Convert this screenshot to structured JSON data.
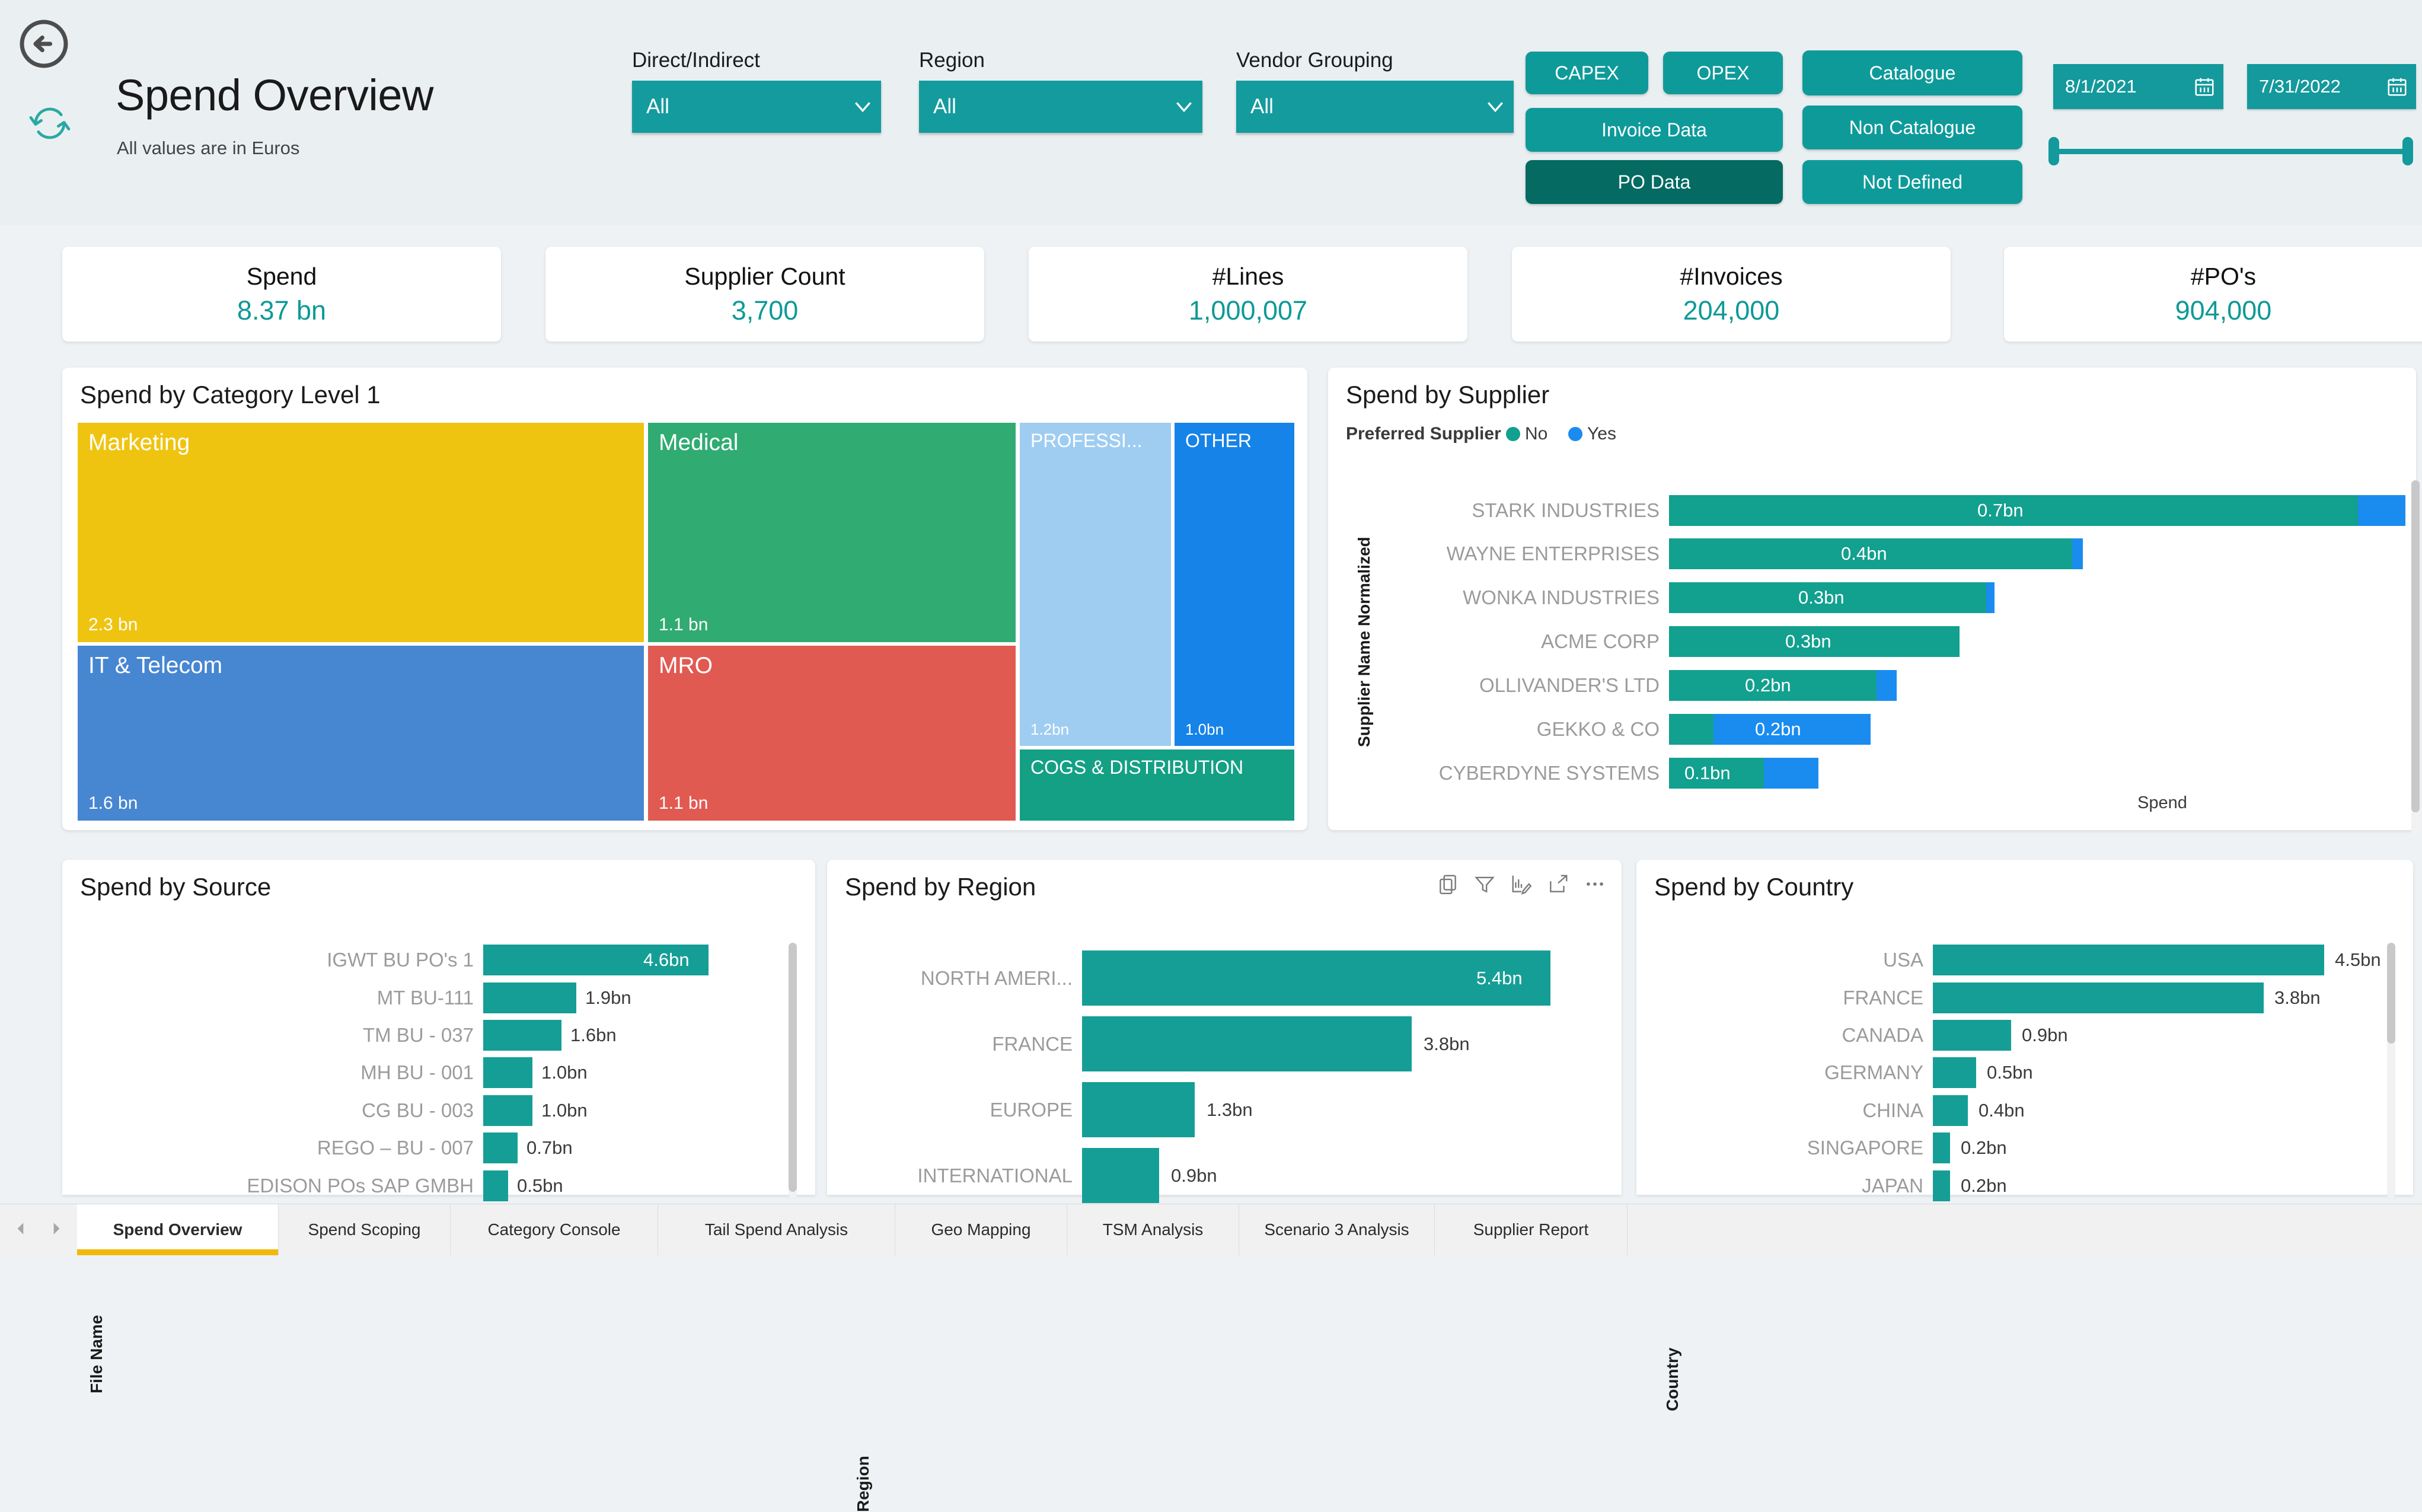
{
  "header": {
    "title": "Spend Overview",
    "subtitle": "All values are in Euros",
    "back_icon": "back-arrow-icon",
    "refresh_icon": "refresh-icon"
  },
  "slicers": [
    {
      "label": "Direct/Indirect",
      "value": "All"
    },
    {
      "label": "Region",
      "value": "All"
    },
    {
      "label": "Vendor Grouping",
      "value": "All"
    }
  ],
  "buttons": [
    {
      "label": "CAPEX",
      "selected": false
    },
    {
      "label": "OPEX",
      "selected": false
    },
    {
      "label": "Catalogue",
      "selected": false
    },
    {
      "label": "Invoice Data",
      "selected": false
    },
    {
      "label": "Non Catalogue",
      "selected": false
    },
    {
      "label": "PO Data",
      "selected": true
    },
    {
      "label": "Not Defined",
      "selected": false
    }
  ],
  "date_range": {
    "start": "8/1/2021",
    "end": "7/31/2022"
  },
  "kpis": [
    {
      "title": "Spend",
      "value": "8.37 bn"
    },
    {
      "title": "Supplier Count",
      "value": "3,700"
    },
    {
      "title": "#Lines",
      "value": "1,000,007"
    },
    {
      "title": "#Invoices",
      "value": "204,000"
    },
    {
      "title": "#PO's",
      "value": "904,000"
    }
  ],
  "panels": {
    "category": {
      "title": "Spend by Category Level 1"
    },
    "supplier": {
      "title": "Spend by Supplier",
      "legend_title": "Preferred Supplier",
      "y_axis": "Supplier Name Normalized",
      "x_axis": "Spend"
    },
    "source": {
      "title": "Spend by Source",
      "y_axis": "File Name"
    },
    "region": {
      "title": "Spend by Region",
      "y_axis": "Region"
    },
    "country": {
      "title": "Spend by Country",
      "y_axis": "Country"
    }
  },
  "viz_toolbar": [
    "copy-icon",
    "filter-icon",
    "personalize-visual-icon",
    "focus-mode-icon",
    "more-options-icon"
  ],
  "colors": {
    "teal": "#0f9a9a",
    "teal_dark": "#046a62",
    "bar_teal": "#159e96",
    "bar_blue": "#1a8cf0",
    "accent_yellow": "#f2b80c"
  },
  "chart_data": [
    {
      "type": "treemap",
      "title": "Spend by Category Level 1",
      "labels": [
        "Marketing",
        "IT & Telecom",
        "Medical",
        "MRO",
        "PROFESSI...",
        "OTHER",
        "COGS & DISTRIBUTION"
      ],
      "values": [
        2.3,
        1.6,
        1.1,
        1.1,
        1.2,
        1.0,
        0.6
      ],
      "value_labels": [
        "2.3 bn",
        "1.6 bn",
        "1.1 bn",
        "1.1 bn",
        "1.2bn",
        "1.0bn",
        ""
      ],
      "colors": [
        "#efc411",
        "#4786d1",
        "#30ab72",
        "#e15a52",
        "#9fcdf2",
        "#1683e8",
        "#14a085"
      ],
      "units": "bn EUR"
    },
    {
      "type": "bar",
      "orientation": "horizontal",
      "stacked": true,
      "title": "Spend by Supplier",
      "ylabel": "Supplier Name Normalized",
      "xlabel": "Spend",
      "categories": [
        "STARK INDUSTRIES",
        "WAYNE ENTERPRISES",
        "WONKA INDUSTRIES",
        "ACME CORP",
        "OLLIVANDER'S LTD",
        "GEKKO & CO",
        "CYBERDYNE SYSTEMS"
      ],
      "legend": [
        {
          "name": "No",
          "color": "#12a08f"
        },
        {
          "name": "Yes",
          "color": "#1a8cf0"
        }
      ],
      "legend_position": "top-left",
      "series": [
        {
          "name": "No",
          "values": [
            0.7,
            0.42,
            0.33,
            0.3,
            0.215,
            0.055,
            0.1
          ]
        },
        {
          "name": "Yes",
          "values": [
            0.048,
            0.01,
            0.008,
            0.0,
            0.03,
            0.165,
            0.095
          ]
        }
      ],
      "data_labels": [
        "0.7bn",
        "0.4bn",
        "0.3bn",
        "0.3bn",
        "0.2bn",
        "0.2bn",
        "0.1bn"
      ]
    },
    {
      "type": "bar",
      "orientation": "horizontal",
      "title": "Spend by Source",
      "ylabel": "File Name",
      "categories": [
        "IGWT BU PO's 1",
        "MT BU-111",
        "TM BU - 037",
        "MH BU - 001",
        "CG BU - 003",
        "REGO – BU - 007",
        "EDISON POs SAP GMBH"
      ],
      "values": [
        4.6,
        1.9,
        1.6,
        1.0,
        1.0,
        0.7,
        0.5
      ],
      "data_labels": [
        "4.6bn",
        "1.9bn",
        "1.6bn",
        "1.0bn",
        "1.0bn",
        "0.7bn",
        "0.5bn"
      ],
      "bar_color": "#159e96",
      "scrollable": true
    },
    {
      "type": "bar",
      "orientation": "horizontal",
      "title": "Spend by Region",
      "ylabel": "Region",
      "categories": [
        "NORTH AMERI...",
        "FRANCE",
        "EUROPE",
        "INTERNATIONAL"
      ],
      "values": [
        5.4,
        3.8,
        1.3,
        0.9
      ],
      "data_labels": [
        "5.4bn",
        "3.8bn",
        "1.3bn",
        "0.9bn"
      ],
      "bar_color": "#159e96"
    },
    {
      "type": "bar",
      "orientation": "horizontal",
      "title": "Spend by Country",
      "ylabel": "Country",
      "categories": [
        "USA",
        "FRANCE",
        "CANADA",
        "GERMANY",
        "CHINA",
        "SINGAPORE",
        "JAPAN"
      ],
      "values": [
        4.5,
        3.8,
        0.9,
        0.5,
        0.4,
        0.2,
        0.2
      ],
      "data_labels": [
        "4.5bn",
        "3.8bn",
        "0.9bn",
        "0.5bn",
        "0.4bn",
        "0.2bn",
        "0.2bn"
      ],
      "bar_color": "#159e96",
      "scrollable": true
    }
  ],
  "tabs": [
    {
      "label": "Spend Overview",
      "active": true
    },
    {
      "label": "Spend Scoping",
      "active": false
    },
    {
      "label": "Category Console",
      "active": false
    },
    {
      "label": "Tail Spend Analysis",
      "active": false
    },
    {
      "label": "Geo Mapping",
      "active": false
    },
    {
      "label": "TSM Analysis",
      "active": false
    },
    {
      "label": "Scenario 3 Analysis",
      "active": false
    },
    {
      "label": "Supplier Report",
      "active": false
    }
  ]
}
